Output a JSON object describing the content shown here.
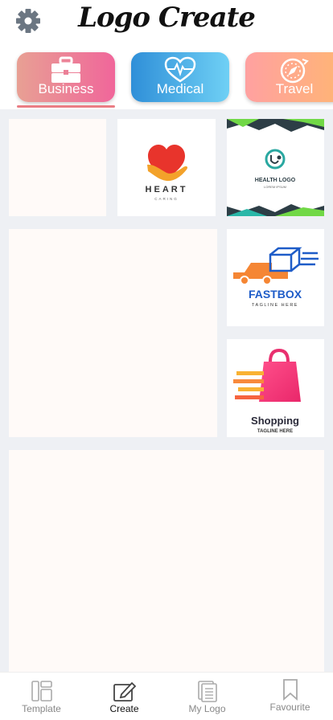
{
  "header": {
    "title": "Logo Create",
    "settings_icon": "gear-icon"
  },
  "categories": [
    {
      "label": "Business",
      "icon": "briefcase-icon",
      "selected": true
    },
    {
      "label": "Medical",
      "icon": "heartbeat-icon",
      "selected": false
    },
    {
      "label": "Travel",
      "icon": "compass-icon",
      "selected": false
    }
  ],
  "logos": {
    "heart": {
      "name": "HEART",
      "tagline": "CARING"
    },
    "health": {
      "name": "HEALTH LOGO",
      "tagline": "LOREM IPSUM"
    },
    "fastbox": {
      "name": "FASTBOX",
      "tagline": "TAGLINE HERE"
    },
    "shopping": {
      "name": "Shopping",
      "tagline": "TAGLINE HERE"
    }
  },
  "tabs": [
    {
      "label": "Template",
      "icon": "template-icon",
      "active": false
    },
    {
      "label": "Create",
      "icon": "edit-icon",
      "active": true
    },
    {
      "label": "My Logo",
      "icon": "documents-icon",
      "active": false
    },
    {
      "label": "Favourite",
      "icon": "bookmark-icon",
      "active": false
    }
  ],
  "colors": {
    "accent": "#ea7d84",
    "grid_bg": "#eef0f4",
    "placeholder": "#fffaf8"
  }
}
